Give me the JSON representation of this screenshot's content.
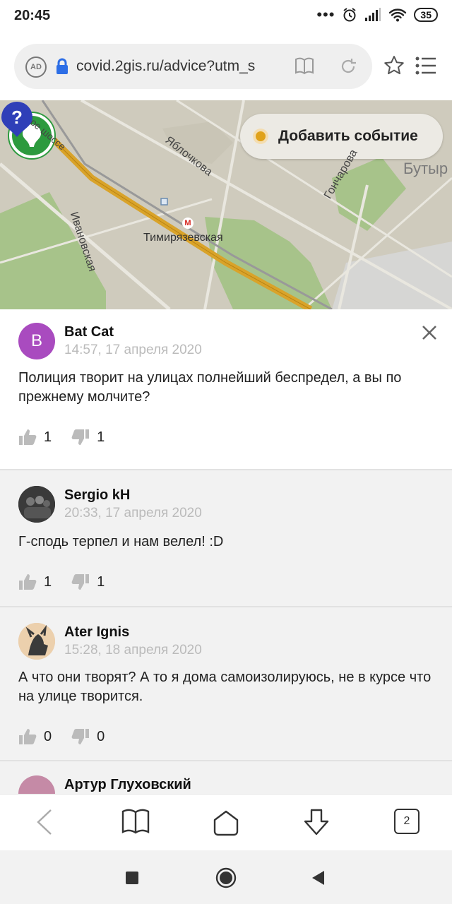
{
  "status_bar": {
    "time": "20:45",
    "battery": "35"
  },
  "browser": {
    "url": "covid.2gis.ru/advice?utm_s",
    "adblock_label": "AD",
    "tabs_count": "2"
  },
  "map": {
    "add_event_label": "Добавить событие",
    "labels": {
      "metro": "Тимирязевская",
      "yablochkova": "Яблочкова",
      "ivanovskaya": "Ивановская",
      "goncharova": "Гончарова",
      "butyr": "Бутыр",
      "shosse": "ское шоссе"
    },
    "metro_icon": "М"
  },
  "comments": [
    {
      "avatar_letter": "B",
      "author": "Bat Cat",
      "date": "14:57, 17 апреля 2020",
      "text": "Полиция творит на улицах полнейший беспредел, а вы по прежнему молчите?",
      "likes": "1",
      "dislikes": "1"
    },
    {
      "author": "Sergio kH",
      "date": "20:33, 17 апреля 2020",
      "text": "Г-сподь терпел и нам велел! :D",
      "likes": "1",
      "dislikes": "1"
    },
    {
      "author": "Ater Ignis",
      "date": "15:28, 18 апреля 2020",
      "text": "А что они творят? А то я дома самоизолируюсь, не в курсе что на улице творится.",
      "likes": "0",
      "dislikes": "0"
    },
    {
      "author": "Артур Глуховский"
    }
  ],
  "colors": {
    "brand_green": "#2c9a3e",
    "event_orange": "#e0a21a",
    "avatar_purple": "#a94bbf"
  }
}
